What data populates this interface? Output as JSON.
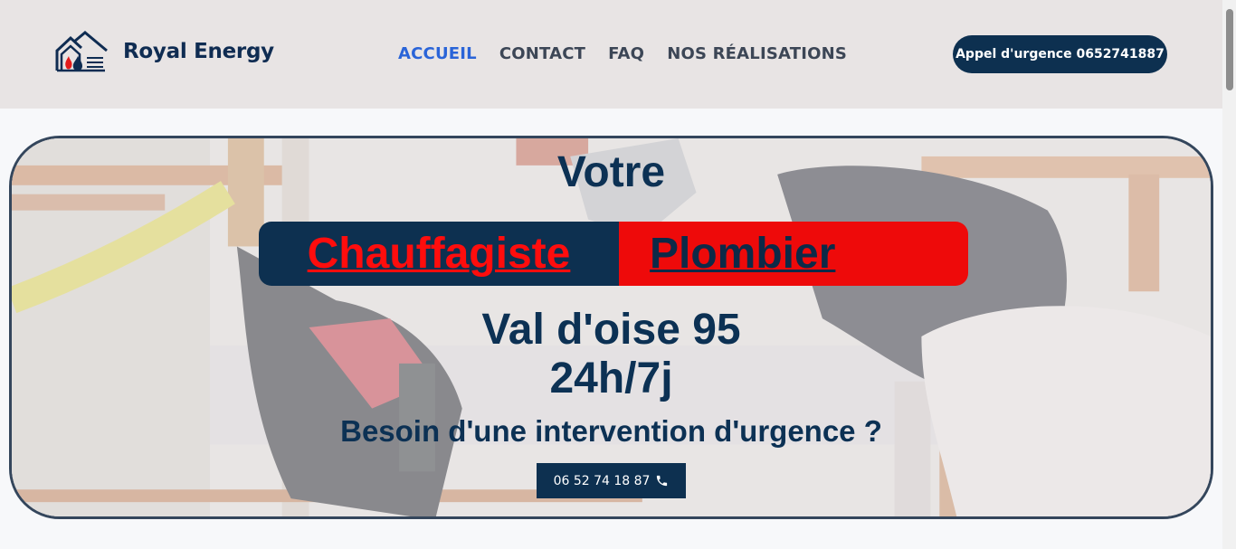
{
  "header": {
    "brand": "Royal Energy",
    "logo_icon": "house-flame-drop-icon",
    "nav": [
      {
        "label": "ACCUEIL",
        "active": true
      },
      {
        "label": "CONTACT",
        "active": false
      },
      {
        "label": "FAQ",
        "active": false
      },
      {
        "label": "NOS RÉALISATIONS",
        "active": false
      }
    ],
    "cta_label": "Appel d'urgence 0652741887"
  },
  "hero": {
    "line1": "Votre",
    "badge_left": "Chauffagiste",
    "badge_right": "Plombier",
    "line2": "Val d'oise 95",
    "line3": "24h/7j",
    "line4": "Besoin d'une intervention d'urgence ?",
    "phone_label": "06 52 74 18 87",
    "phone_icon": "phone-icon",
    "background_image": "plumber-hands-pipes-photo"
  },
  "colors": {
    "header_bg": "#e8e4e4",
    "navy": "#0d3050",
    "active_nav": "#2a64d8",
    "red": "#ee0a0a"
  }
}
